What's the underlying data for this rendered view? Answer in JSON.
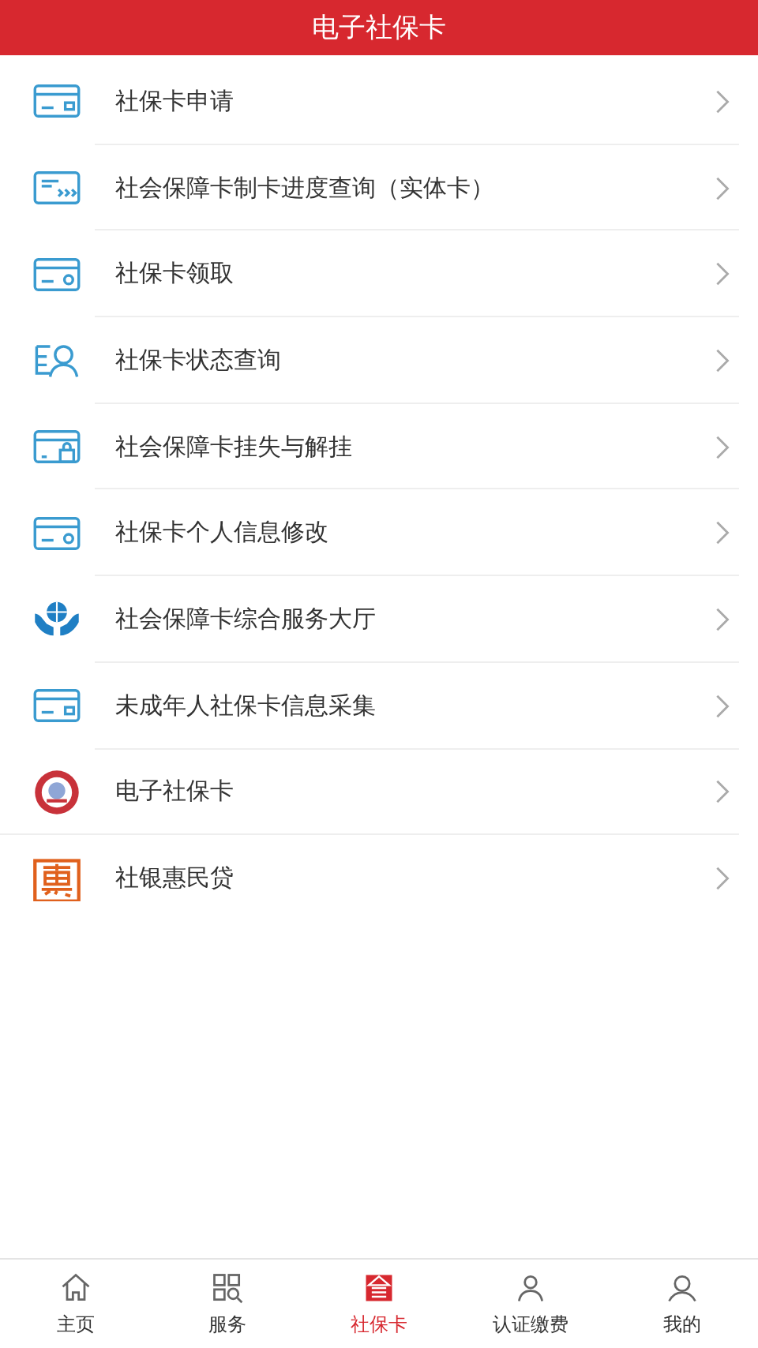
{
  "header": {
    "title": "电子社保卡"
  },
  "items": [
    {
      "label": "社保卡申请",
      "kind": "card"
    },
    {
      "label": "社会保障卡制卡进度查询（实体卡）",
      "kind": "card-arrows"
    },
    {
      "label": "社保卡领取",
      "kind": "card-dot"
    },
    {
      "label": "社保卡状态查询",
      "kind": "person-list"
    },
    {
      "label": "社会保障卡挂失与解挂",
      "kind": "card-lock"
    },
    {
      "label": "社保卡个人信息修改",
      "kind": "card-dot"
    },
    {
      "label": "社会保障卡综合服务大厅",
      "kind": "hands-globe"
    },
    {
      "label": "未成年人社保卡信息采集",
      "kind": "card"
    },
    {
      "label": "电子社保卡",
      "kind": "emblem"
    },
    {
      "label": "社银惠民贷",
      "kind": "seal"
    }
  ],
  "tabbar": [
    {
      "label": "主页",
      "kind": "home",
      "selected": false
    },
    {
      "label": "服务",
      "kind": "grid",
      "selected": false
    },
    {
      "label": "社保卡",
      "kind": "card",
      "selected": true
    },
    {
      "label": "认证缴费",
      "kind": "person",
      "selected": false
    },
    {
      "label": "我的",
      "kind": "user",
      "selected": false
    }
  ]
}
